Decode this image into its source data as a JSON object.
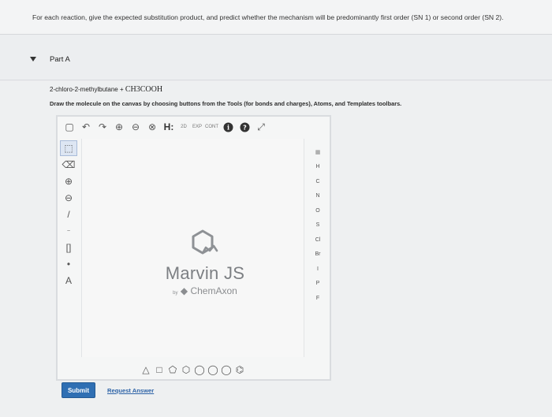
{
  "instructions": {
    "text": "For each reaction, give the expected substitution product, and predict whether the mechanism will be predominantly first order (SN 1) or second order (SN 2)."
  },
  "part": {
    "label": "Part A"
  },
  "question": {
    "reactant": "2-chloro-2-methylbutane",
    "plus": "+",
    "reagent": "CH3COOH",
    "draw_instruction": "Draw the molecule on the canvas by choosing buttons from the Tools (for bonds and charges), Atoms, and Templates toolbars."
  },
  "sketcher": {
    "top_toolbar": {
      "new": "▢",
      "undo": "↶",
      "redo": "↷",
      "zoom_in": "⊕",
      "zoom_out": "⊖",
      "clean": "⊗",
      "hydrogens": "H:",
      "mode_2d": "2D",
      "explicit": "EXP",
      "cont": "CONT",
      "info": "i",
      "help": "?",
      "expand": "⤢"
    },
    "left_toolbar": {
      "select": "⬚",
      "erase": "⌫",
      "charge_plus": "⊕",
      "charge_minus": "⊖",
      "bond": "/",
      "chain": "~",
      "bracket": "[]",
      "electron": "•",
      "text": "A"
    },
    "right_toolbar": {
      "periodic_table": "▦",
      "atoms": [
        "H",
        "C",
        "N",
        "O",
        "S",
        "Cl",
        "Br",
        "I",
        "P",
        "F"
      ]
    },
    "bottom_toolbar": [
      "△",
      "□",
      "⬠",
      "⬡",
      "◯",
      "◯",
      "◯",
      "⌬"
    ],
    "logo": {
      "name": "Marvin JS",
      "by": "by",
      "vendor": "ChemAxon"
    }
  },
  "actions": {
    "submit": "Submit",
    "request_answer": "Request Answer"
  }
}
